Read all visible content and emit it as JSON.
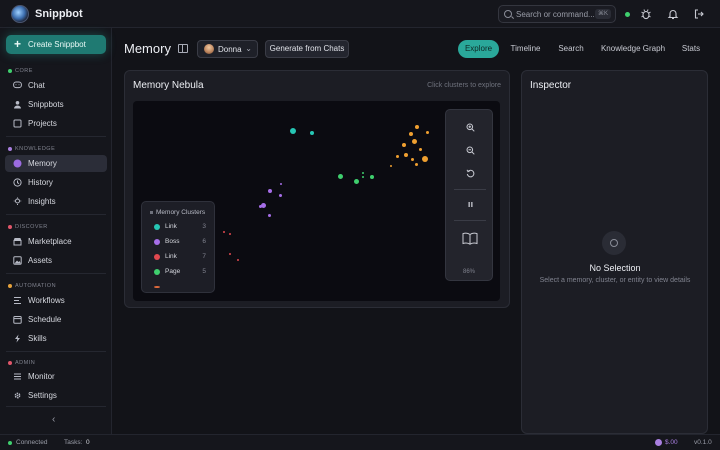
{
  "app": {
    "name": "Snippbot"
  },
  "topbar": {
    "search_placeholder": "Search or command...",
    "search_shortcut": "⌘K",
    "icons": [
      "bug-icon",
      "bell-icon",
      "logout-icon"
    ]
  },
  "sidebar": {
    "create_label": "Create Snippbot",
    "sections": [
      {
        "label": "CORE",
        "dot_color": "#3fcf6e"
      },
      {
        "label": "KNOWLEDGE",
        "dot_color": "#a97fe0"
      },
      {
        "label": "DISCOVER",
        "dot_color": "#e0566a"
      },
      {
        "label": "AUTOMATION",
        "dot_color": "#e6a23c"
      },
      {
        "label": "ADMIN",
        "dot_color": "#e0566a"
      }
    ],
    "items": [
      {
        "label": "Chat",
        "icon": "chat-icon"
      },
      {
        "label": "Snippbots",
        "icon": "user-icon"
      },
      {
        "label": "Projects",
        "icon": "folder-icon"
      },
      {
        "label": "Memory",
        "icon": "memory-icon",
        "active": true
      },
      {
        "label": "History",
        "icon": "history-icon"
      },
      {
        "label": "Insights",
        "icon": "insights-icon"
      },
      {
        "label": "Marketplace",
        "icon": "shop-icon"
      },
      {
        "label": "Assets",
        "icon": "image-icon"
      },
      {
        "label": "Workflows",
        "icon": "workflow-icon"
      },
      {
        "label": "Schedule",
        "icon": "calendar-icon"
      },
      {
        "label": "Skills",
        "icon": "bolt-icon"
      },
      {
        "label": "Monitor",
        "icon": "monitor-icon"
      },
      {
        "label": "Settings",
        "icon": "gear-icon"
      }
    ]
  },
  "header": {
    "title": "Memory",
    "user": "Donna",
    "generate_label": "Generate from Chats",
    "tabs": [
      {
        "label": "Explore",
        "active": true
      },
      {
        "label": "Timeline"
      },
      {
        "label": "Search"
      },
      {
        "label": "Knowledge Graph"
      },
      {
        "label": "Stats"
      }
    ]
  },
  "nebula": {
    "title": "Memory Nebula",
    "hint": "Click clusters to explore",
    "zoom": "86%",
    "legend": {
      "title": "Memory Clusters",
      "items": [
        {
          "name": "Link",
          "count": "3",
          "color": "#26c6b4"
        },
        {
          "name": "Boss",
          "count": "6",
          "color": "#a66ee8"
        },
        {
          "name": "Link",
          "count": "7",
          "color": "#e0484f"
        },
        {
          "name": "Page",
          "count": "5",
          "color": "#3fcf6e"
        }
      ]
    }
  },
  "inspector": {
    "title": "Inspector",
    "empty_title": "No Selection",
    "empty_hint": "Select a memory, cluster, or entity to view details"
  },
  "statusbar": {
    "connection": "Connected",
    "tasks_label": "Tasks:",
    "tasks_count": "0",
    "cost": "$.00",
    "version": "v0.1.0"
  }
}
